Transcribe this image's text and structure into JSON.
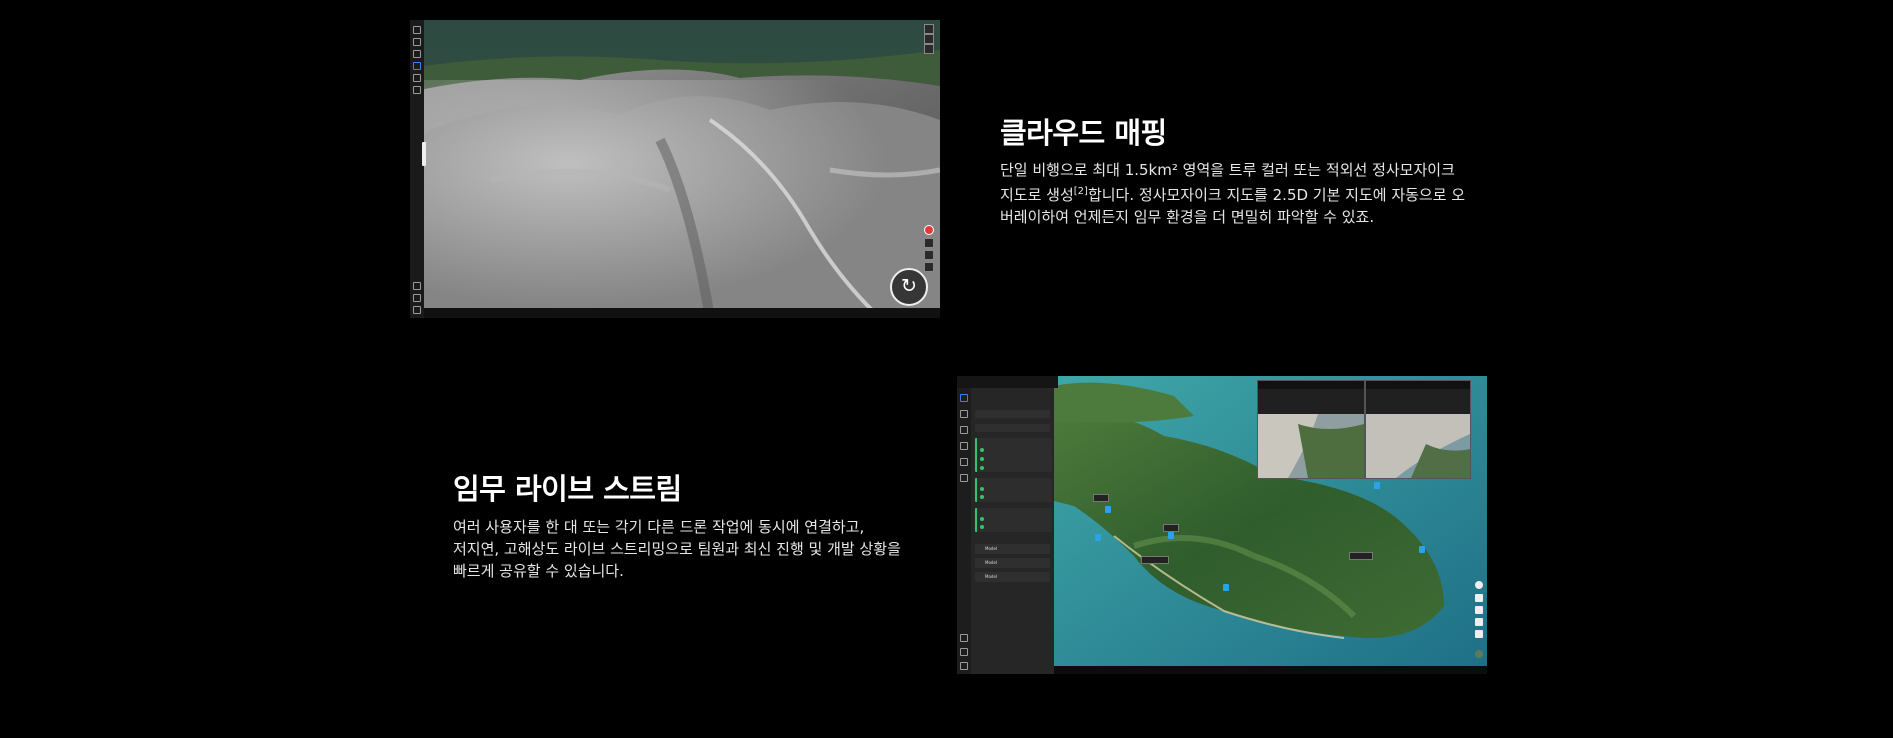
{
  "cloud_mapping": {
    "title": "클라우드 매핑",
    "desc_part1": "단일 비행으로 최대 1.5km² 영역을 트루 컬러 또는 적외선 정사모자이크 지도로 생성",
    "footnote": "[2]",
    "desc_part2": "합니다. 정사모자이크 지도를 2.5D 기본 지도에 자동으로 오버레이하여 언제든지 임무 환경을 더 면밀히 파악할 수 있죠.",
    "screenshot": {
      "refresh_icon": "↻"
    }
  },
  "live_stream": {
    "title": "임무 라이브 스트림",
    "desc_lines": [
      "여러 사용자를 한 대 또는 각기 다른 드론 작업에 동시에 연결하고,",
      "저지연, 고해상도 라이브 스트리밍으로 팀원과 최신 진행 및 개발 상황을",
      "빠르게 공유할 수 있습니다."
    ],
    "screenshot": {
      "panel_items": [
        "Model",
        "Model",
        "Model"
      ]
    }
  },
  "colors": {
    "background": "#000000",
    "text": "#ffffff",
    "accent_green": "#39c16b",
    "pin_blue": "#2aa3e8"
  }
}
